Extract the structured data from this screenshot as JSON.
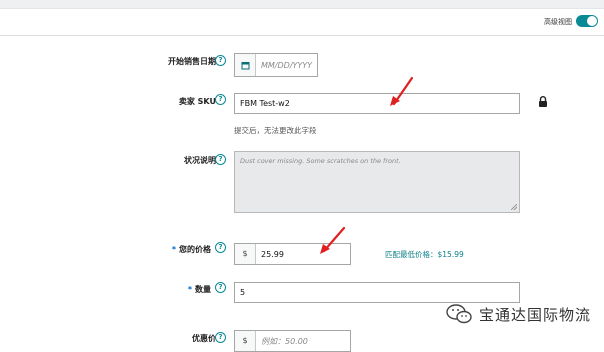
{
  "header": {
    "advanced_view_label": "高级视图",
    "advanced_view_on": true,
    "accent": "#0a8a95"
  },
  "form": {
    "start_date": {
      "label": "开始销售日期",
      "placeholder": "MM/DD/YYYY"
    },
    "sku": {
      "label": "卖家 SKU",
      "value": "FBM Test-w2",
      "note": "提交后，无法更改此字段"
    },
    "condition": {
      "label": "状况说明",
      "placeholder": "Dust cover missing. Some scratches on the front."
    },
    "price": {
      "label": "您的价格",
      "currency": "$",
      "value": "25.99",
      "lowest_price_text": "匹配最低价格：$15.99"
    },
    "quantity": {
      "label": "数量",
      "value": "5"
    },
    "sale_price": {
      "label": "优惠价",
      "currency": "$",
      "placeholder": "例如：50.00"
    }
  },
  "watermark": {
    "text": "宝通达国际物流"
  }
}
